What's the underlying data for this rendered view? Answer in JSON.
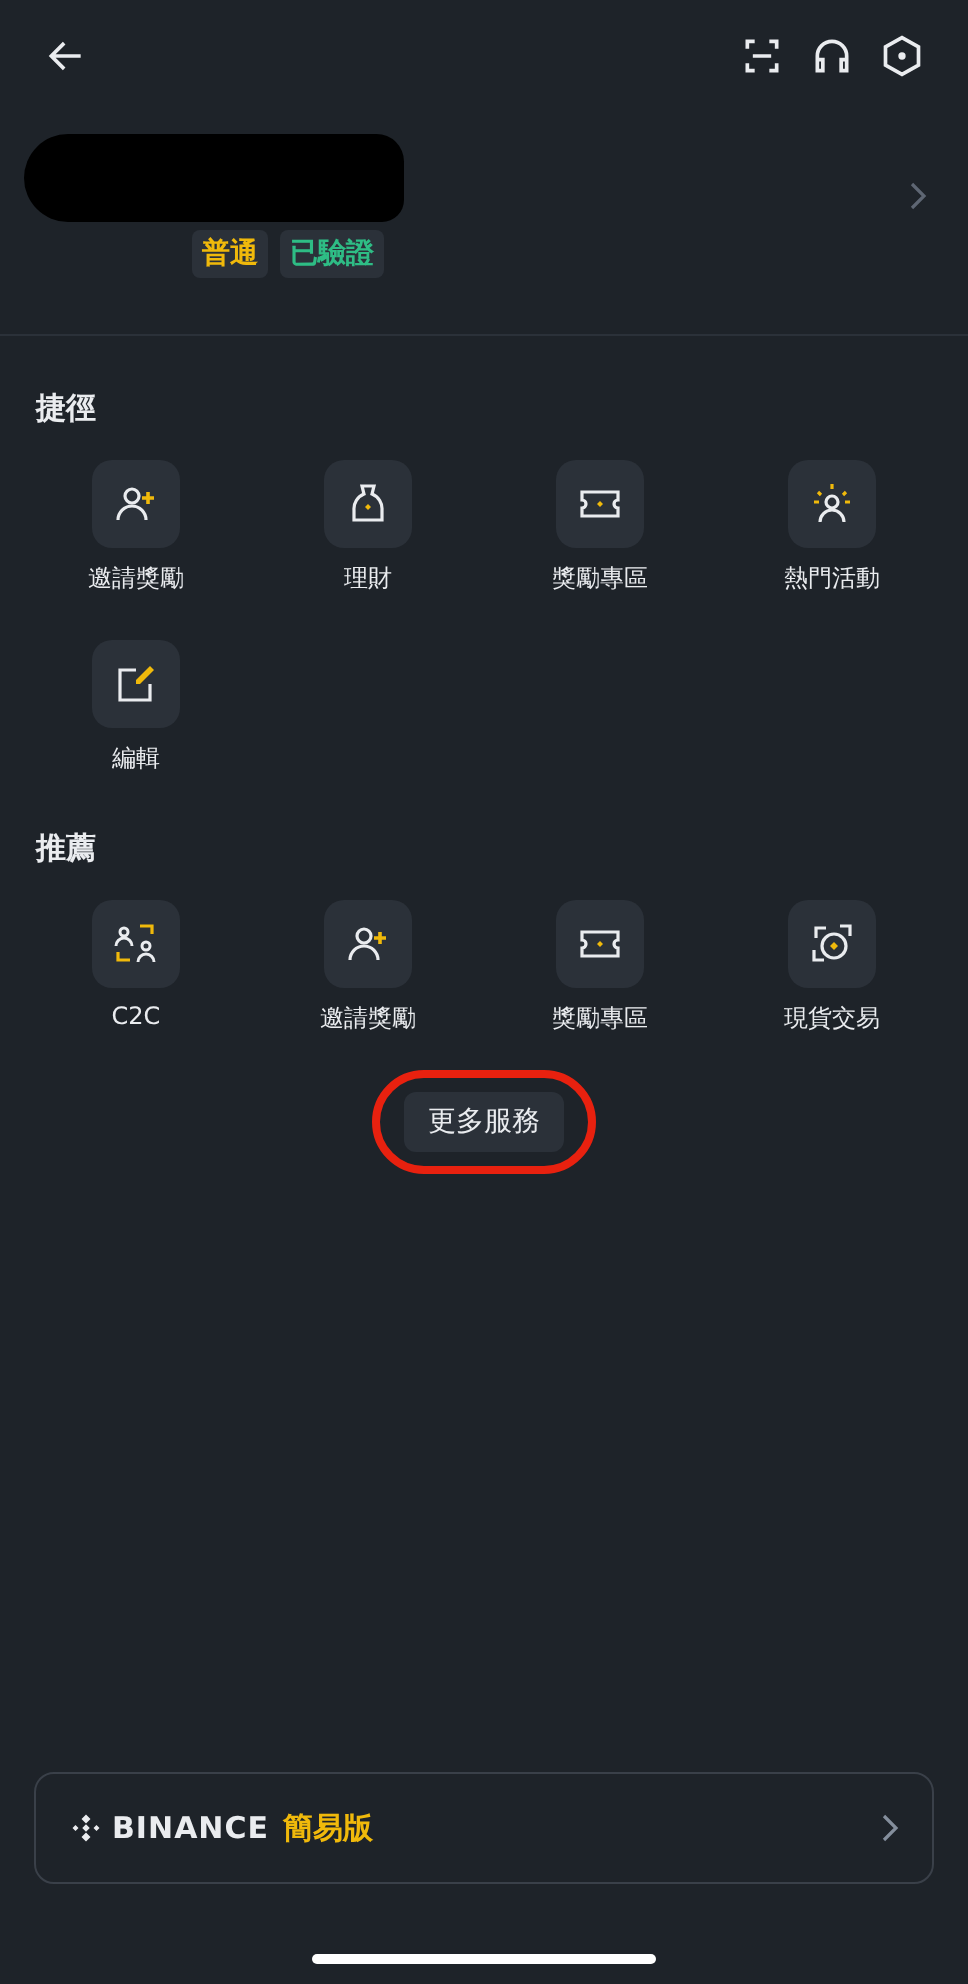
{
  "profile": {
    "tags": [
      {
        "label": "普通",
        "color": "#f0b90b"
      },
      {
        "label": "已驗證",
        "color": "#2ebd85"
      }
    ]
  },
  "shortcuts": {
    "title": "捷徑",
    "items": [
      {
        "label": "邀請獎勵",
        "kind": "invite"
      },
      {
        "label": "理財",
        "kind": "finance"
      },
      {
        "label": "獎勵專區",
        "kind": "reward"
      },
      {
        "label": "熱門活動",
        "kind": "activity"
      },
      {
        "label": "編輯",
        "kind": "edit"
      }
    ]
  },
  "recommended": {
    "title": "推薦",
    "items": [
      {
        "label": "C2C",
        "kind": "c2c"
      },
      {
        "label": "邀請獎勵",
        "kind": "invite"
      },
      {
        "label": "獎勵專區",
        "kind": "reward"
      },
      {
        "label": "現貨交易",
        "kind": "spot"
      }
    ]
  },
  "more_button": "更多服務",
  "lite_banner": {
    "brand": "BINANCE",
    "label": "簡易版"
  }
}
